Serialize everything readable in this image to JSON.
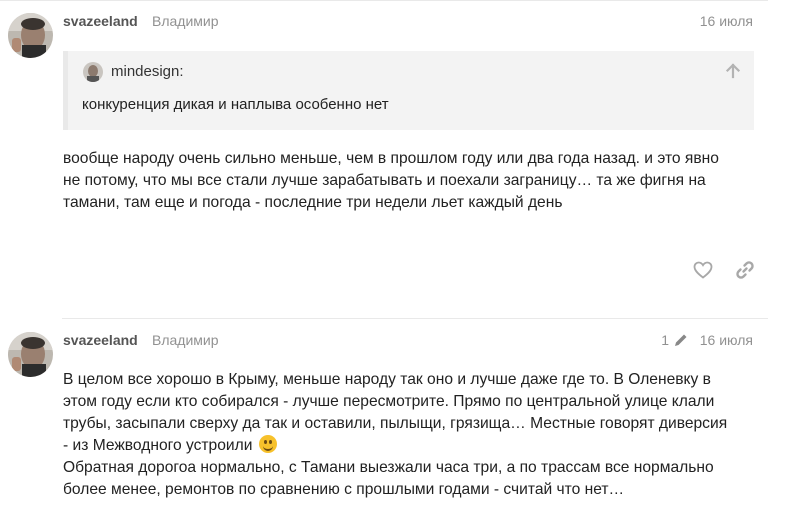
{
  "posts": [
    {
      "username": "svazeeland",
      "full_name": "Владимир",
      "date": "16 июля",
      "quote": {
        "author": "mindesign:",
        "text": "конкуренция дикая и наплыва особенно нет"
      },
      "lines": [
        "вообще народу очень сильно меньше, чем в прошлом году или два года назад. и это явно",
        "не потому, что мы все стали лучше зарабатывать и поехали заграницу… та же фигня на",
        "тамани, там еще и погода - последние три недели льет каждый день"
      ]
    },
    {
      "username": "svazeeland",
      "full_name": "Владимир",
      "edit_count": "1",
      "date": "16 июля",
      "lines": [
        "В целом все хорошо в Крыму, меньше народу так оно и лучше даже где то. В Оленевку в",
        "этом году если кто собирался - лучше пересмотрите. Прямо по центральной улице клали",
        "трубы, засыпали сверху да так и оставили, пылыщи, грязища… Местные говорят диверсия",
        "- из Межводного устроили",
        "Обратная дорогоа нормально, с Тамани выезжали часа три, а по трассам все нормально",
        "более менее, ремонтов по сравнению с прошлыми годами - считай что нет…"
      ]
    }
  ],
  "icons": {
    "like": "heart-icon",
    "share": "link-icon",
    "quote_jump": "arrow-up-icon",
    "edit": "pencil-icon",
    "emoji": "slightly-smiling-face-emoji"
  },
  "colors": {
    "muted": "#919191",
    "username": "#555555",
    "quote_bg": "#f3f3f3",
    "quote_border": "#e9e9e9"
  }
}
